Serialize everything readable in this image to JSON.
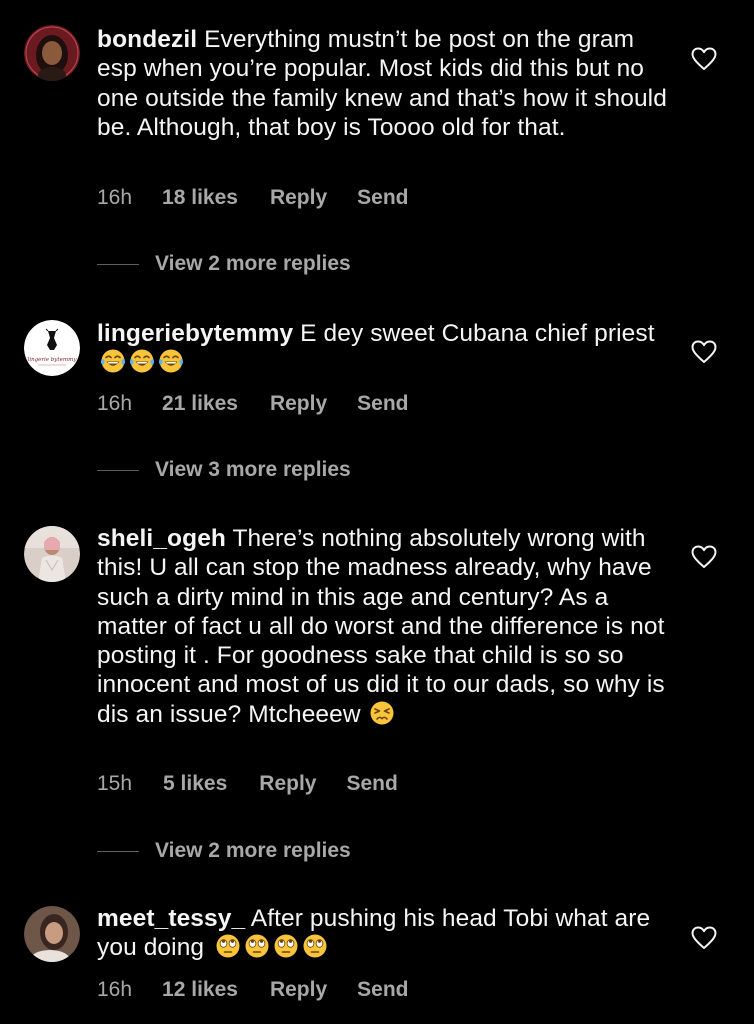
{
  "colors": {
    "background": "#000000",
    "text": "#f5f5f5",
    "secondary": "#a8a8a8",
    "divider": "#5e5e5e"
  },
  "comments": [
    {
      "username": "bondezil",
      "text": "Everything mustn’t be post on the gram esp when you’re popular. Most kids did this but no one outside the family knew and that’s how it should be. Although, that boy is Toooo old for that.",
      "time": "16h",
      "likes": "18 likes",
      "reply": "Reply",
      "send": "Send",
      "view_replies": "View 2 more replies",
      "avatar_icon": "avatar-photo-icon",
      "like_icon": "heart-outline-icon"
    },
    {
      "username": "lingeriebytemmy",
      "text": "E dey sweet Cubana chief priest",
      "emoji": "face-with-tears-of-joy",
      "emoji_count": 3,
      "time": "16h",
      "likes": "21 likes",
      "reply": "Reply",
      "send": "Send",
      "view_replies": "View 3 more replies",
      "avatar_icon": "lingerie-logo-icon",
      "avatar_logo_text": "lingerie bytemmy",
      "like_icon": "heart-outline-icon"
    },
    {
      "username": "sheli_ogeh",
      "text": "There’s nothing absolutely wrong with this! U all can stop the madness already, why have such a dirty mind in this age and century? As a matter of fact u all do worst and the difference is not posting it . For goodness sake that child is so so innocent and most of us did it to our dads, so why is dis an issue? Mtcheeew",
      "emoji": "persevering-face",
      "emoji_count": 1,
      "time": "15h",
      "likes": "5 likes",
      "reply": "Reply",
      "send": "Send",
      "view_replies": "View 2 more replies",
      "avatar_icon": "avatar-photo-icon",
      "like_icon": "heart-outline-icon"
    },
    {
      "username": "meet_tessy_",
      "text": "After pushing his head Tobi what are you doing",
      "emoji": "face-with-rolling-eyes",
      "emoji_count": 4,
      "time": "16h",
      "likes": "12 likes",
      "reply": "Reply",
      "send": "Send",
      "avatar_icon": "avatar-photo-icon",
      "like_icon": "heart-outline-icon"
    }
  ]
}
